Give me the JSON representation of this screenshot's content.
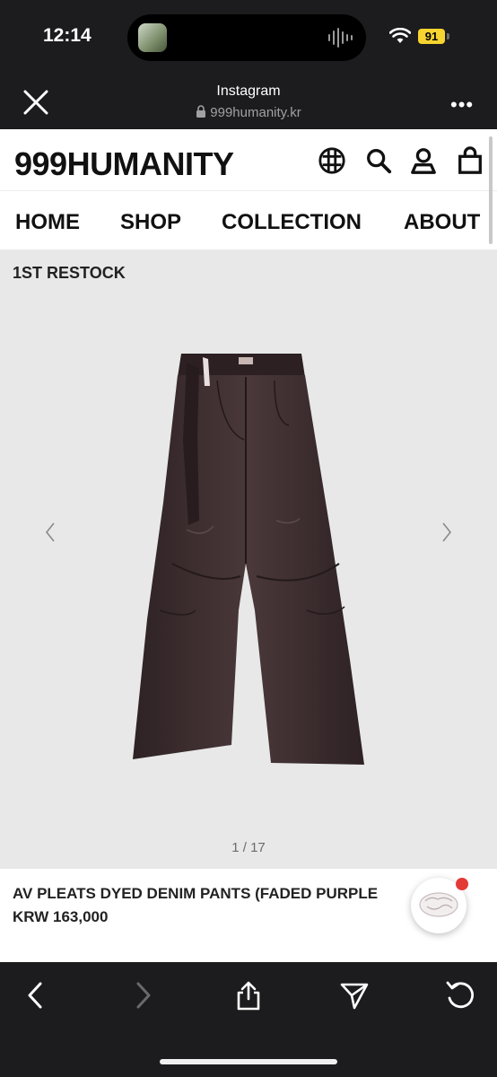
{
  "status_bar": {
    "time": "12:14",
    "battery": "91"
  },
  "browser": {
    "title": "Instagram",
    "url": "999humanity.kr"
  },
  "site": {
    "brand": "999HUMANITY",
    "nav": [
      "HOME",
      "SHOP",
      "COLLECTION",
      "ABOUT"
    ]
  },
  "product": {
    "badge": "1ST RESTOCK",
    "image_counter": "1 / 17",
    "name": "AV PLEATS DYED DENIM PANTS (FADED PURPLE",
    "price": "KRW 163,000"
  },
  "icons": [
    "close-icon",
    "lock-icon",
    "more-icon",
    "globe-icon",
    "search-icon",
    "user-icon",
    "bag-icon",
    "chevron-left-icon",
    "chevron-right-icon",
    "back-icon",
    "forward-icon",
    "share-icon",
    "send-icon",
    "reload-icon"
  ],
  "colors": {
    "chrome": "#1c1c1e",
    "product_bg": "#e8e8e8",
    "battery": "#f7d430",
    "notification": "#e53935",
    "pants": "#3a2a2c"
  }
}
